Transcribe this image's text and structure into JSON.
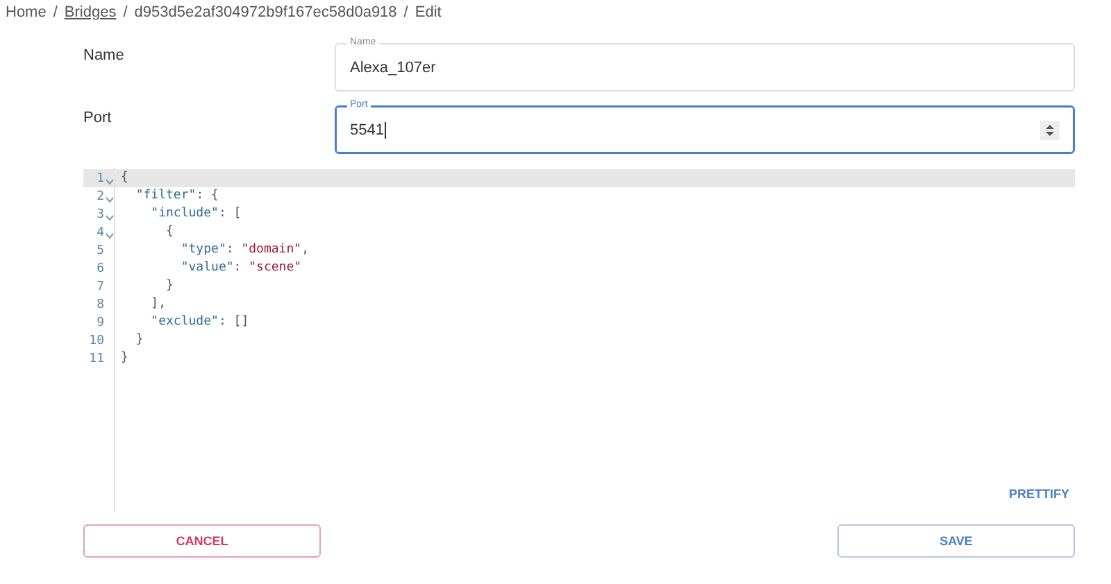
{
  "breadcrumb": [
    {
      "label": "Home",
      "link": false
    },
    {
      "separator": "/",
      "label": "Bridges",
      "link": true
    },
    {
      "separator": "/",
      "label": "d953d5e2af304972b9f167ec58d0a918",
      "link": false
    },
    {
      "separator": "/",
      "label": "Edit",
      "link": false
    }
  ],
  "fields": [
    {
      "label": "Name",
      "legend": "Name",
      "value": "Alexa_107er",
      "focused": false,
      "kind": "text"
    },
    {
      "label": "Port",
      "legend": "Port",
      "value": "5541",
      "focused": true,
      "kind": "number"
    }
  ],
  "editor": {
    "lines": [
      {
        "number": "1",
        "fold": true,
        "selected": true,
        "tokens": [
          {
            "kind": "punct",
            "text": "{"
          }
        ]
      },
      {
        "number": "2",
        "fold": true,
        "selected": false,
        "tokens": [
          {
            "kind": "key",
            "text": "  \"filter\""
          },
          {
            "kind": "punct",
            "text": ": {"
          }
        ]
      },
      {
        "number": "3",
        "fold": true,
        "selected": false,
        "tokens": [
          {
            "kind": "key",
            "text": "    \"include\""
          },
          {
            "kind": "punct",
            "text": ": ["
          }
        ]
      },
      {
        "number": "4",
        "fold": true,
        "selected": false,
        "tokens": [
          {
            "kind": "punct",
            "text": "      {"
          }
        ]
      },
      {
        "number": "5",
        "fold": false,
        "selected": false,
        "tokens": [
          {
            "kind": "key",
            "text": "        \"type\""
          },
          {
            "kind": "punct",
            "text": ": "
          },
          {
            "kind": "string",
            "text": "\"domain\""
          },
          {
            "kind": "punct",
            "text": ","
          }
        ]
      },
      {
        "number": "6",
        "fold": false,
        "selected": false,
        "tokens": [
          {
            "kind": "key",
            "text": "        \"value\""
          },
          {
            "kind": "punct",
            "text": ": "
          },
          {
            "kind": "string",
            "text": "\"scene\""
          }
        ]
      },
      {
        "number": "7",
        "fold": false,
        "selected": false,
        "tokens": [
          {
            "kind": "punct",
            "text": "      }"
          }
        ]
      },
      {
        "number": "8",
        "fold": false,
        "selected": false,
        "tokens": [
          {
            "kind": "punct",
            "text": "    ],"
          }
        ]
      },
      {
        "number": "9",
        "fold": false,
        "selected": false,
        "tokens": [
          {
            "kind": "key",
            "text": "    \"exclude\""
          },
          {
            "kind": "punct",
            "text": ": []"
          }
        ]
      },
      {
        "number": "10",
        "fold": false,
        "selected": false,
        "tokens": [
          {
            "kind": "punct",
            "text": "  }"
          }
        ]
      },
      {
        "number": "11",
        "fold": false,
        "selected": false,
        "tokens": [
          {
            "kind": "punct",
            "text": "}"
          }
        ]
      }
    ],
    "prettify": "PRETTIFY"
  },
  "buttons": [
    {
      "label": "CANCEL",
      "kind": "cancel"
    },
    {
      "label": "SAVE",
      "kind": "save"
    }
  ]
}
